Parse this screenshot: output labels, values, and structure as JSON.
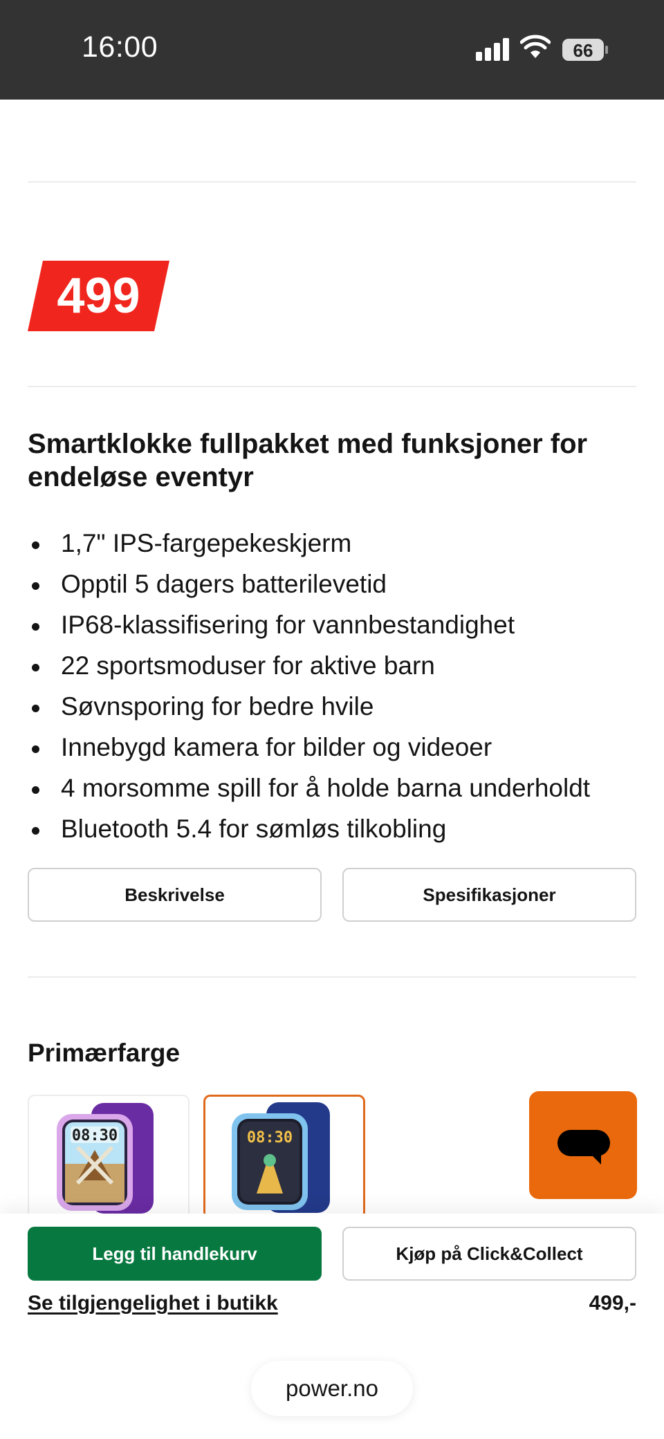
{
  "status_bar": {
    "time": "16:00",
    "battery_level": "66",
    "icons": [
      "signal-icon",
      "wifi-icon",
      "battery-icon"
    ]
  },
  "price": {
    "value": "499",
    "tag_color": "#f0261e"
  },
  "product": {
    "title": "Smartklokke fullpakket med funksjoner for endeløse eventyr",
    "features": [
      "1,7\" IPS-fargepekeskjerm",
      "Opptil 5 dagers batterilevetid",
      "IP68-klassifisering for vannbestandighet",
      "22 sportsmoduser for aktive barn",
      "Søvnsporing for bedre hvile",
      "Innebygd kamera for bilder og videoer",
      "4 morsomme spill for å holde barna underholdt",
      "Bluetooth 5.4 for sømløs tilkobling"
    ]
  },
  "tabs": {
    "description": "Beskrivelse",
    "specifications": "Spesifikasjoner"
  },
  "color_selector": {
    "title": "Primærfarge",
    "options": [
      {
        "name": "purple",
        "screen_time": "08:30",
        "selected": false
      },
      {
        "name": "blue",
        "screen_time": "08:30",
        "selected": true
      }
    ]
  },
  "chat": {
    "icon": "chat-bubble-icon",
    "color": "#e9690c"
  },
  "actions": {
    "add_to_cart": "Legg til handlekurv",
    "click_collect": "Kjøp på Click&Collect",
    "availability": "Se tilgjengelighet i butikk",
    "price": "499,-",
    "primary_color": "#07783f",
    "selected_border_color": "#e06a1c"
  },
  "browser": {
    "url": "power.no"
  }
}
